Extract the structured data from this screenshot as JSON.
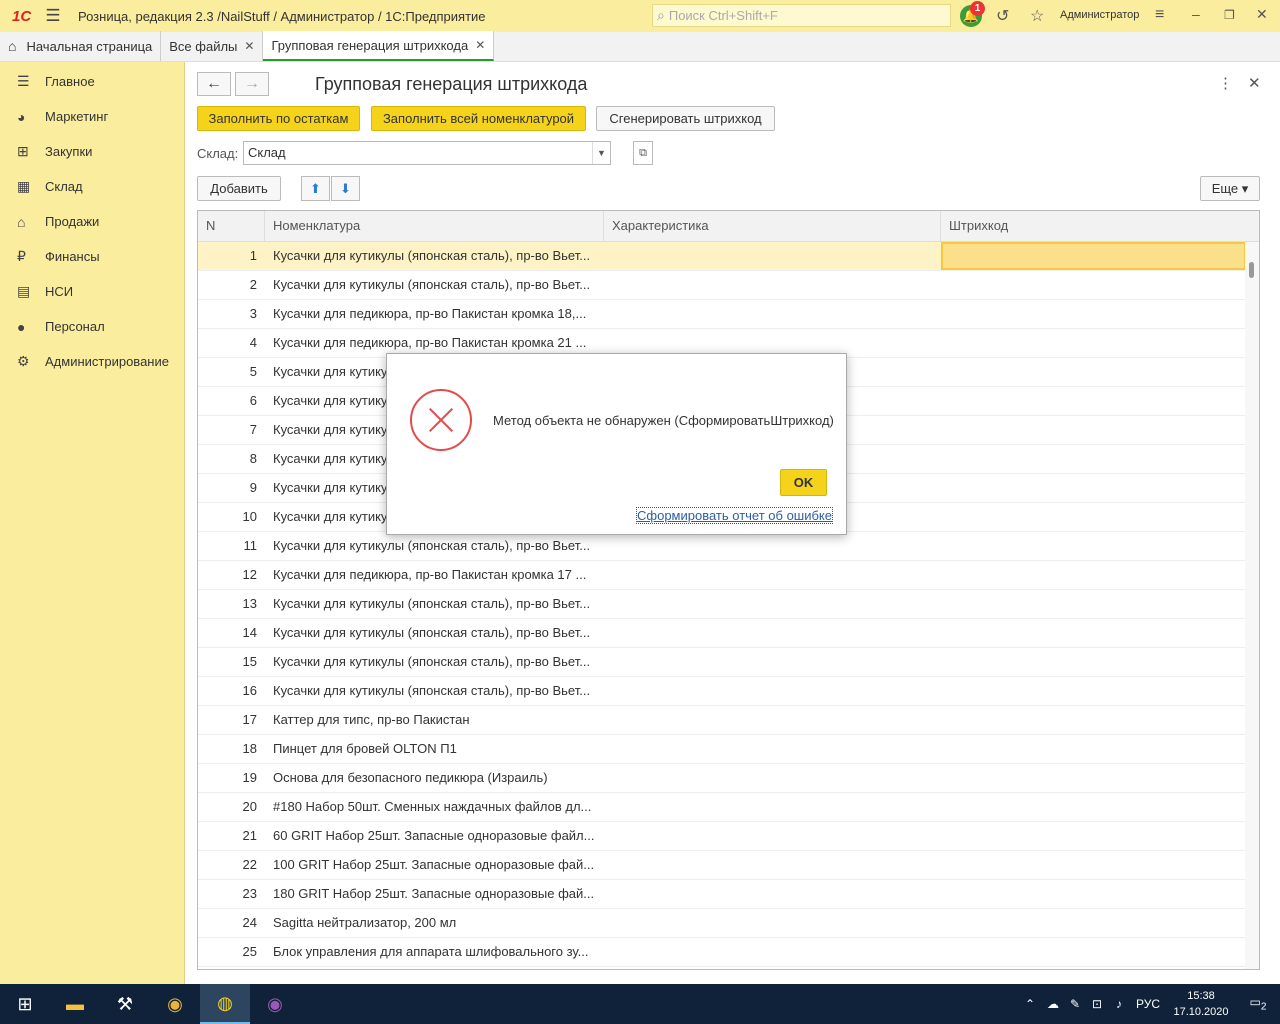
{
  "app": {
    "title": "Розница, редакция 2.3 /NailStuff / Администратор / 1С:Предприятие",
    "logo": "1С",
    "search_placeholder": "Поиск Ctrl+Shift+F",
    "notifications": "1",
    "user": "Администратор"
  },
  "tabs": [
    {
      "label": "Начальная страница"
    },
    {
      "label": "Все файлы"
    },
    {
      "label": "Групповая генерация штрихкода"
    }
  ],
  "sidebar": {
    "items": [
      {
        "label": "Главное",
        "icon": "menu-icon"
      },
      {
        "label": "Маркетинг",
        "icon": "pie-icon"
      },
      {
        "label": "Закупки",
        "icon": "cart-icon"
      },
      {
        "label": "Склад",
        "icon": "grid-icon"
      },
      {
        "label": "Продажи",
        "icon": "bag-icon"
      },
      {
        "label": "Финансы",
        "icon": "ruble-icon"
      },
      {
        "label": "НСИ",
        "icon": "book-icon"
      },
      {
        "label": "Персонал",
        "icon": "person-icon"
      },
      {
        "label": "Администрирование",
        "icon": "gear-icon"
      }
    ]
  },
  "form": {
    "title": "Групповая генерация штрихкода",
    "fill_stock": "Заполнить по остаткам",
    "fill_all": "Заполнить всей номенклатурой",
    "generate": "Сгенерировать штрихкод",
    "warehouse_label": "Склад:",
    "warehouse_value": "Склад",
    "add": "Добавить",
    "more": "Еще"
  },
  "table": {
    "columns": [
      "N",
      "Номенклатура",
      "Характеристика",
      "Штрихкод"
    ],
    "rows": [
      {
        "n": "1",
        "name": "Кусачки для кутикулы (японская сталь), пр-во Вьет..."
      },
      {
        "n": "2",
        "name": "Кусачки для кутикулы (японская сталь), пр-во Вьет..."
      },
      {
        "n": "3",
        "name": "Кусачки для педикюра, пр-во Пакистан кромка 18,..."
      },
      {
        "n": "4",
        "name": "Кусачки для педикюра, пр-во Пакистан кромка 21 ..."
      },
      {
        "n": "5",
        "name": "Кусачки для кутику"
      },
      {
        "n": "6",
        "name": "Кусачки для кутику"
      },
      {
        "n": "7",
        "name": "Кусачки для кутику"
      },
      {
        "n": "8",
        "name": "Кусачки для кутику"
      },
      {
        "n": "9",
        "name": "Кусачки для кутику"
      },
      {
        "n": "10",
        "name": "Кусачки для кутику"
      },
      {
        "n": "11",
        "name": "Кусачки для кутикулы (японская сталь), пр-во Вьет..."
      },
      {
        "n": "12",
        "name": "Кусачки для педикюра, пр-во Пакистан кромка 17 ..."
      },
      {
        "n": "13",
        "name": "Кусачки для кутикулы (японская сталь), пр-во Вьет..."
      },
      {
        "n": "14",
        "name": "Кусачки для кутикулы (японская сталь), пр-во Вьет..."
      },
      {
        "n": "15",
        "name": "Кусачки для кутикулы (японская сталь), пр-во Вьет..."
      },
      {
        "n": "16",
        "name": "Кусачки для кутикулы (японская сталь), пр-во Вьет..."
      },
      {
        "n": "17",
        "name": "Каттер для типс, пр-во Пакистан"
      },
      {
        "n": "18",
        "name": "Пинцет для бровей OLTON П1"
      },
      {
        "n": "19",
        "name": "Основа для безопасного педикюра (Израиль)"
      },
      {
        "n": "20",
        "name": "#180 Набор 50шт. Сменных наждачных файлов дл..."
      },
      {
        "n": "21",
        "name": "60 GRIT Набор 25шт. Запасные одноразовые файл..."
      },
      {
        "n": "22",
        "name": "100 GRIT Набор 25шт. Запасные одноразовые фай..."
      },
      {
        "n": "23",
        "name": "180 GRIT Набор 25шт. Запасные одноразовые фай..."
      },
      {
        "n": "24",
        "name": "Sagitta нейтрализатор, 200 мл"
      },
      {
        "n": "25",
        "name": "Блок управления для аппарата шлифовального зу..."
      }
    ]
  },
  "dialog": {
    "message": "Метод объекта не обнаружен (СформироватьШтрихкод)",
    "ok": "OK",
    "report_link": "Сформировать отчет об ошибке"
  },
  "taskbar": {
    "lang": "РУС",
    "time": "15:38",
    "date": "17.10.2020",
    "notif_count": "2"
  }
}
